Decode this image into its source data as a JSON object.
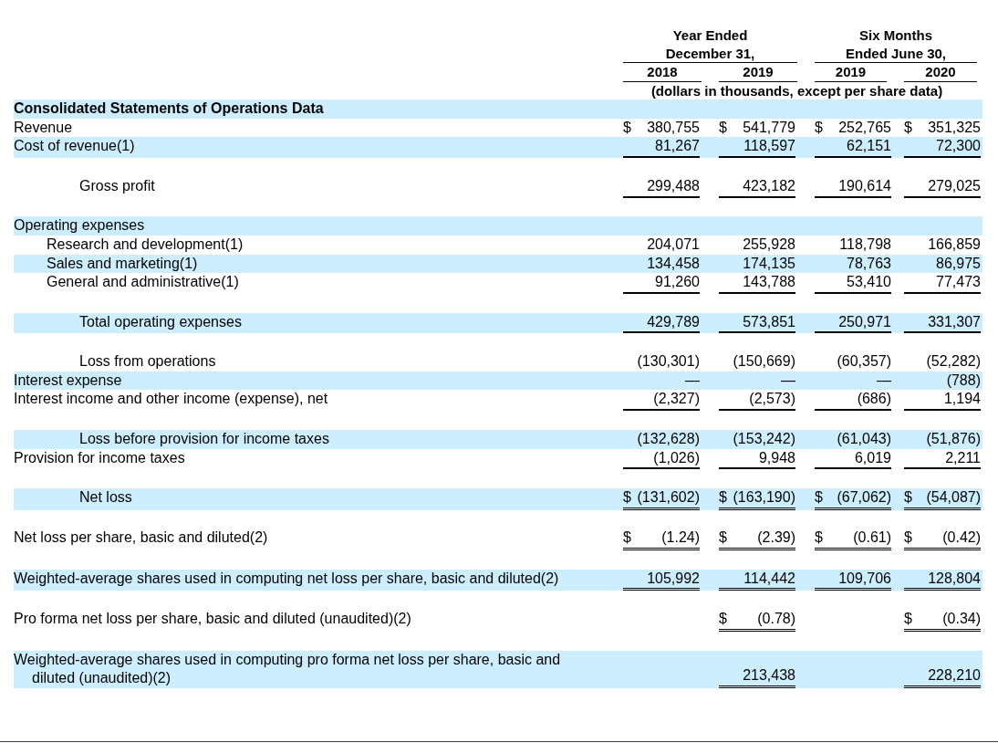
{
  "header": {
    "groups": [
      {
        "label": "Year Ended\nDecember 31,"
      },
      {
        "label": "Six Months\nEnded June 30,"
      }
    ],
    "years": [
      "2018",
      "2019",
      "2019",
      "2020"
    ],
    "unit_note": "(dollars in thousands, except per share data)"
  },
  "rows": [
    {
      "label": "Consolidated Statements of Operations Data",
      "kind": "section",
      "shaded": true,
      "blank_before": false,
      "cells": []
    },
    {
      "label": "Revenue",
      "kind": "line",
      "shaded": false,
      "blank_before": false,
      "cells": [
        {
          "symbol": "$",
          "value": "380,755"
        },
        {
          "symbol": "$",
          "value": "541,779"
        },
        {
          "symbol": "$",
          "value": "252,765"
        },
        {
          "symbol": "$",
          "value": "351,325"
        }
      ]
    },
    {
      "label": "Cost of revenue(1)",
      "kind": "line",
      "shaded": true,
      "blank_before": false,
      "underlined": true,
      "double_underline": false,
      "cells": [
        {
          "value": "81,267"
        },
        {
          "value": "118,597"
        },
        {
          "value": "62,151"
        },
        {
          "value": "72,300"
        }
      ]
    },
    {
      "label": "Gross profit",
      "kind": "total",
      "shaded": false,
      "blank_before": true,
      "underlined": true,
      "double_underline": false,
      "cells": [
        {
          "value": "299,488"
        },
        {
          "value": "423,182"
        },
        {
          "value": "190,614"
        },
        {
          "value": "279,025"
        }
      ]
    },
    {
      "label": "Operating expenses",
      "kind": "group",
      "shaded": true,
      "blank_before": true,
      "cells": [],
      "children": [
        {
          "label": "Research and development(1)",
          "shaded": false,
          "cells": [
            {
              "value": "204,071"
            },
            {
              "value": "255,928"
            },
            {
              "value": "118,798"
            },
            {
              "value": "166,859"
            }
          ]
        },
        {
          "label": "Sales and marketing(1)",
          "shaded": true,
          "cells": [
            {
              "value": "134,458"
            },
            {
              "value": "174,135"
            },
            {
              "value": "78,763"
            },
            {
              "value": "86,975"
            }
          ]
        },
        {
          "label": "General and administrative(1)",
          "shaded": false,
          "underlined": true,
          "double_underline": false,
          "cells": [
            {
              "value": "91,260"
            },
            {
              "value": "143,788"
            },
            {
              "value": "53,410"
            },
            {
              "value": "77,473"
            }
          ]
        }
      ]
    },
    {
      "label": "Total operating expenses",
      "kind": "total",
      "shaded": true,
      "blank_before": true,
      "underlined": true,
      "double_underline": false,
      "cells": [
        {
          "value": "429,789"
        },
        {
          "value": "573,851"
        },
        {
          "value": "250,971"
        },
        {
          "value": "331,307"
        }
      ]
    },
    {
      "label": "Loss from operations",
      "kind": "total",
      "shaded": false,
      "blank_before": true,
      "cells": [
        {
          "value": "(130,301)"
        },
        {
          "value": "(150,669)"
        },
        {
          "value": "(60,357)"
        },
        {
          "value": "(52,282)"
        }
      ]
    },
    {
      "label": "Interest expense",
      "kind": "line",
      "shaded": true,
      "blank_before": false,
      "cells": [
        {
          "value": "—"
        },
        {
          "value": "—"
        },
        {
          "value": "—"
        },
        {
          "value": "(788)"
        }
      ]
    },
    {
      "label": "Interest income and other income (expense), net",
      "kind": "line",
      "shaded": false,
      "blank_before": false,
      "underlined": true,
      "double_underline": false,
      "cells": [
        {
          "value": "(2,327)"
        },
        {
          "value": "(2,573)"
        },
        {
          "value": "(686)"
        },
        {
          "value": "1,194"
        }
      ]
    },
    {
      "label": "Loss before provision for income taxes",
      "kind": "total",
      "shaded": true,
      "blank_before": true,
      "cells": [
        {
          "value": "(132,628)"
        },
        {
          "value": "(153,242)"
        },
        {
          "value": "(61,043)"
        },
        {
          "value": "(51,876)"
        }
      ]
    },
    {
      "label": "Provision for income taxes",
      "kind": "line",
      "shaded": false,
      "blank_before": false,
      "underlined": true,
      "double_underline": false,
      "cells": [
        {
          "value": "(1,026)"
        },
        {
          "value": "9,948"
        },
        {
          "value": "6,019"
        },
        {
          "value": "2,211"
        }
      ]
    },
    {
      "label": "Net loss",
      "kind": "total",
      "shaded": true,
      "blank_before": true,
      "underlined": true,
      "double_underline": true,
      "cells": [
        {
          "symbol": "$",
          "value": "(131,602)"
        },
        {
          "symbol": "$",
          "value": "(163,190)"
        },
        {
          "symbol": "$",
          "value": "(67,062)"
        },
        {
          "symbol": "$",
          "value": "(54,087)"
        }
      ]
    },
    {
      "label": "Net loss per share, basic and diluted(2)",
      "kind": "line",
      "shaded": false,
      "blank_before": true,
      "underlined": true,
      "double_underline": true,
      "cells": [
        {
          "symbol": "$",
          "value": "(1.24)"
        },
        {
          "symbol": "$",
          "value": "(2.39)"
        },
        {
          "symbol": "$",
          "value": "(0.61)"
        },
        {
          "symbol": "$",
          "value": "(0.42)"
        }
      ]
    },
    {
      "label": "Weighted-average shares used in computing net loss per share, basic and diluted(2)",
      "kind": "line",
      "shaded": true,
      "blank_before": true,
      "underlined": true,
      "double_underline": true,
      "cells": [
        {
          "value": "105,992"
        },
        {
          "value": "114,442"
        },
        {
          "value": "109,706"
        },
        {
          "value": "128,804"
        }
      ]
    },
    {
      "label": "Pro forma net loss per share, basic and diluted (unaudited)(2)",
      "kind": "line",
      "shaded": false,
      "blank_before": true,
      "underlined": true,
      "double_underline": true,
      "cells": [
        null,
        {
          "symbol": "$",
          "value": "(0.78)"
        },
        null,
        {
          "symbol": "$",
          "value": "(0.34)"
        }
      ]
    },
    {
      "label": "Weighted-average shares used in computing pro forma net loss per share, basic and diluted (unaudited)(2)",
      "kind": "line",
      "shaded": true,
      "blank_before": true,
      "underlined": true,
      "double_underline": true,
      "cells": [
        null,
        {
          "value": "213,438"
        },
        null,
        {
          "value": "228,210"
        }
      ]
    }
  ]
}
